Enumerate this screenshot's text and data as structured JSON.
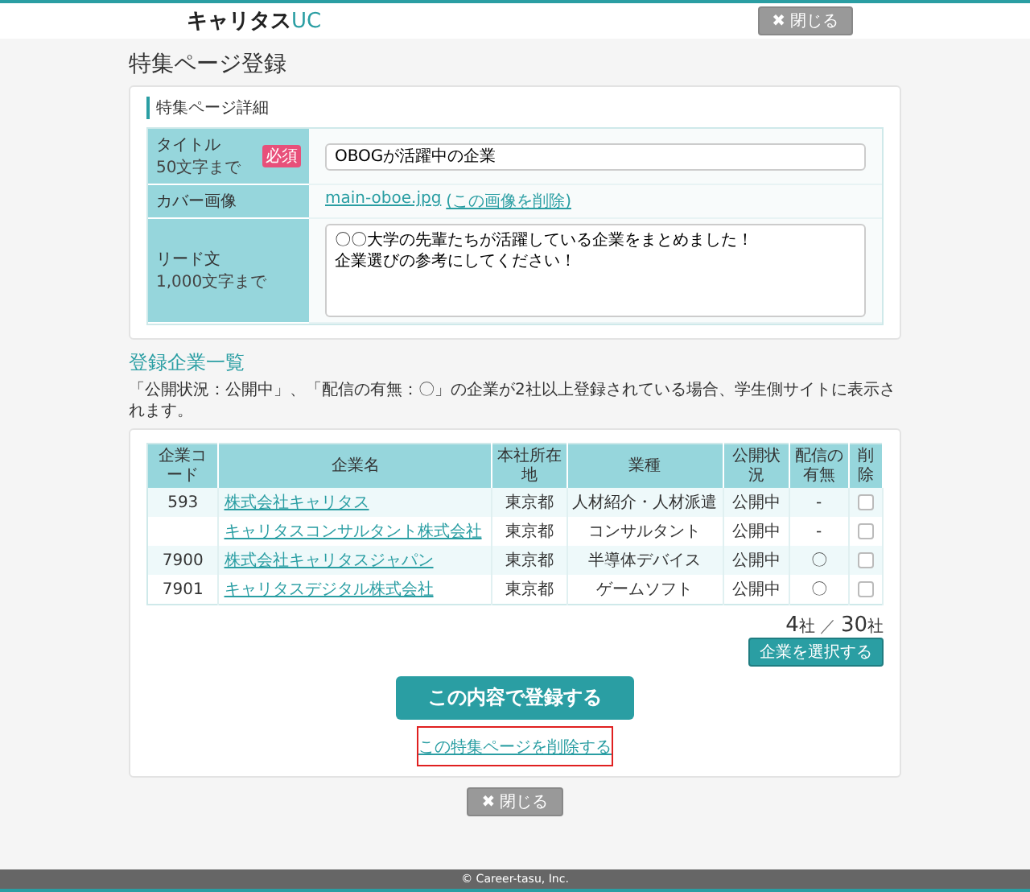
{
  "header": {
    "logo": {
      "brand": "キャリタス",
      "suffix": "UC"
    },
    "close_button": {
      "icon": "✖",
      "label": "閉じる"
    }
  },
  "page_title": "特集ページ登録",
  "details": {
    "heading": "特集ページ詳細",
    "fields": [
      {
        "kind": "input",
        "label": "タイトル",
        "hint": "50文字まで",
        "required_badge": "必須",
        "value": "OBOGが活躍中の企業"
      },
      {
        "kind": "file",
        "label": "カバー画像",
        "file_link": "main-oboe.jpg",
        "delete_link": "(この画像を削除)"
      },
      {
        "kind": "textarea",
        "label": "リード文",
        "hint": "1,000文字まで",
        "lines": [
          "〇〇大学の先輩たちが活躍している企業をまとめました！",
          "企業選びの参考にしてください！"
        ]
      }
    ]
  },
  "companies": {
    "heading": "登録企業一覧",
    "note": "「公開状況：公開中」、「配信の有無：〇」の企業が2社以上登録されている場合、学生側サイトに表示されます。",
    "columns": [
      "企業コード",
      "企業名",
      "本社所在地",
      "業種",
      "公開状況",
      "配信の有無",
      "削除"
    ],
    "rows": [
      {
        "code": "593",
        "name": "株式会社キャリタス",
        "location": "東京都",
        "industry": "人材紹介・人材派遣",
        "status": "公開中",
        "delivery": "-",
        "checked": false
      },
      {
        "name": "キャリタスコンサルタント株式会社",
        "location": "東京都",
        "industry": "コンサルタント",
        "status": "公開中",
        "delivery": "-",
        "checked": false
      },
      {
        "code": "7900",
        "name": "株式会社キャリタスジャパン",
        "location": "東京都",
        "industry": "半導体デバイス",
        "status": "公開中",
        "delivery": "〇",
        "checked": false
      },
      {
        "code": "7901",
        "name": "キャリタスデジタル株式会社",
        "location": "東京都",
        "industry": "ゲームソフト",
        "status": "公開中",
        "delivery": "〇",
        "checked": false
      }
    ],
    "count": {
      "current": "4",
      "current_unit": "社",
      "separator": "／",
      "max": "30",
      "max_unit": "社"
    },
    "select_button": "企業を選択する"
  },
  "submit_button": "この内容で登録する",
  "delete_page_link": {
    "label": "この特集ページを削除する",
    "highlighted": true
  },
  "footer_close_button": {
    "icon": "✖",
    "label": "閉じる"
  },
  "copyright": "© Career-tasu, Inc."
}
